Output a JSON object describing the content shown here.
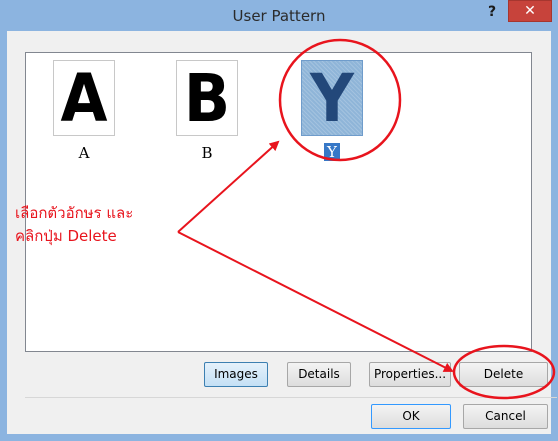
{
  "window": {
    "title": "User Pattern",
    "help_label": "?",
    "close_label": "✕"
  },
  "patterns": [
    {
      "glyph": "A",
      "label": "A",
      "selected": false
    },
    {
      "glyph": "B",
      "label": "B",
      "selected": false
    },
    {
      "glyph": "Y",
      "label": "Y",
      "selected": true
    }
  ],
  "view_buttons": {
    "images": "Images",
    "details": "Details",
    "properties": "Properties...",
    "delete": "Delete"
  },
  "dialog_buttons": {
    "ok": "OK",
    "cancel": "Cancel"
  },
  "annotation": {
    "line1": "เลือกตัวอักษร และ",
    "line2": "คลิกปุ่ม Delete",
    "color": "#e8141d"
  }
}
